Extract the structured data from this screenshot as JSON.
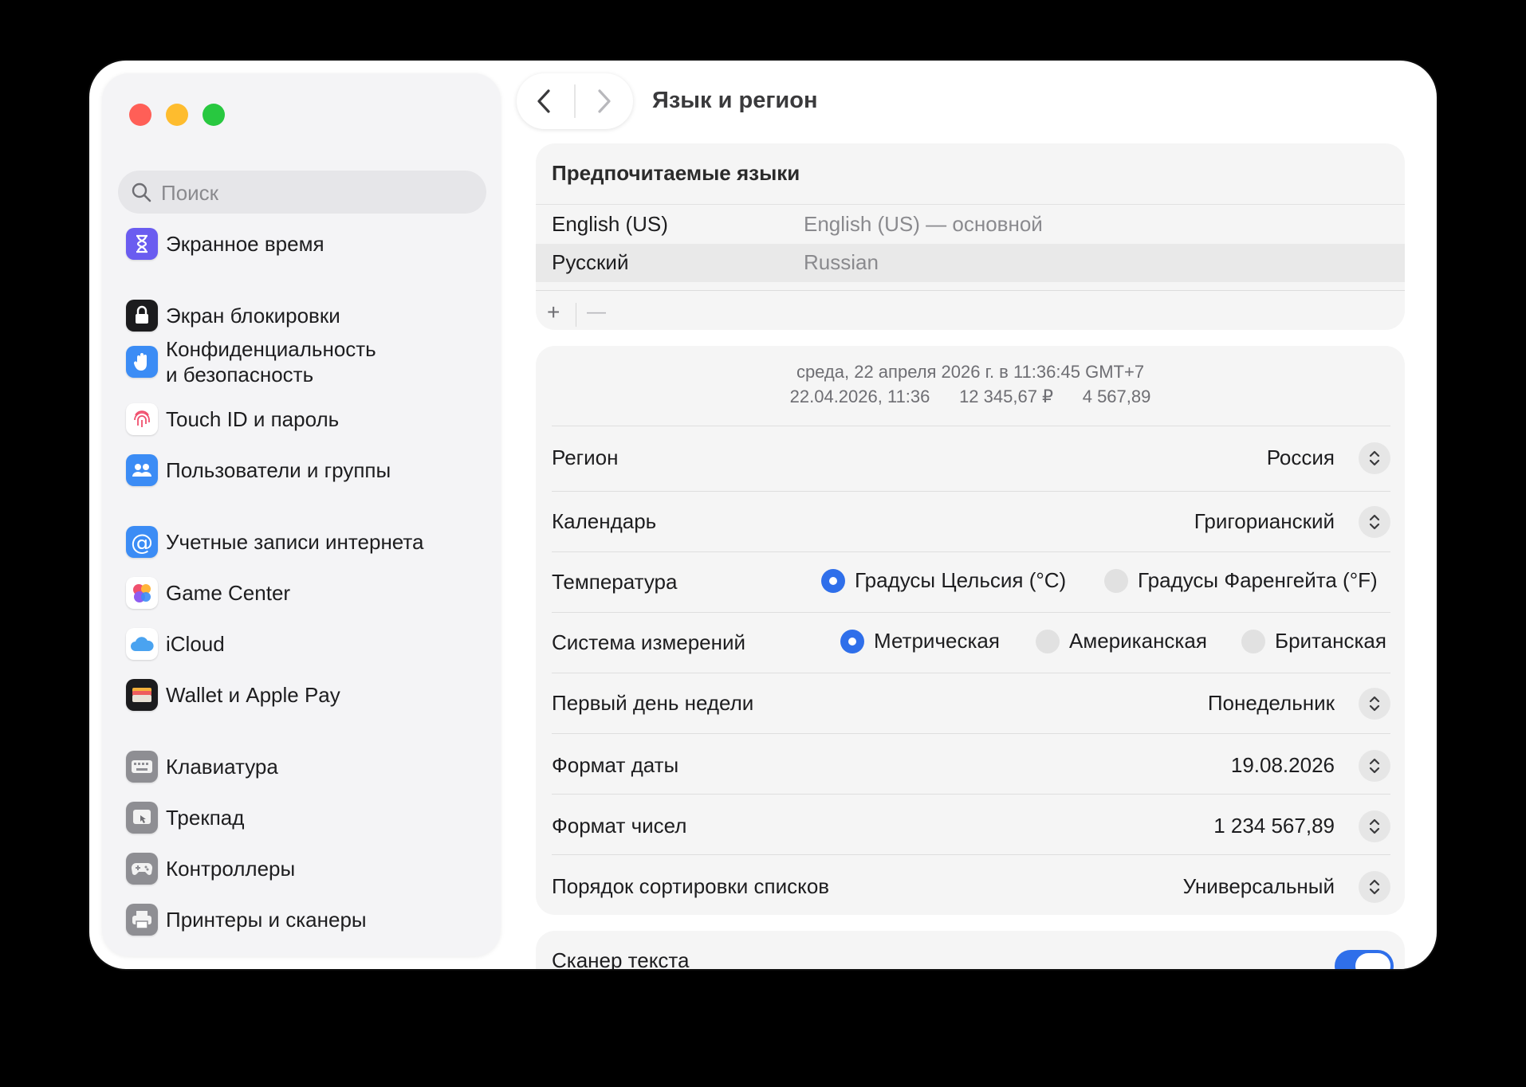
{
  "window": {
    "title": "Язык и регион"
  },
  "sidebar": {
    "search_placeholder": "Поиск",
    "items": [
      {
        "label": "Экранное время",
        "icon": "hourglass-icon"
      },
      {
        "label": "Экран блокировки",
        "icon": "lock-screen-icon"
      },
      {
        "label": "Конфиденциальность\nи безопасность",
        "icon": "hand-icon"
      },
      {
        "label": "Touch ID и пароль",
        "icon": "fingerprint-icon"
      },
      {
        "label": "Пользователи и группы",
        "icon": "users-icon"
      },
      {
        "label": "Учетные записи интернета",
        "icon": "at-icon"
      },
      {
        "label": "Game Center",
        "icon": "game-center-icon"
      },
      {
        "label": "iCloud",
        "icon": "cloud-icon"
      },
      {
        "label": "Wallet и Apple Pay",
        "icon": "wallet-icon"
      },
      {
        "label": "Клавиатура",
        "icon": "keyboard-icon"
      },
      {
        "label": "Трекпад",
        "icon": "trackpad-icon"
      },
      {
        "label": "Контроллеры",
        "icon": "gamepad-icon"
      },
      {
        "label": "Принтеры и сканеры",
        "icon": "printer-icon"
      }
    ]
  },
  "languages": {
    "heading": "Предпочитаемые языки",
    "rows": [
      {
        "name": "English (US)",
        "detail": "English (US) — основной"
      },
      {
        "name": "Русский",
        "detail": "Russian"
      }
    ],
    "add_label": "+",
    "remove_label": "—"
  },
  "region": {
    "preview_line1": "среда, 22 апреля 2026 г. в 11:36:45 GMT+7",
    "preview_line2": "22.04.2026, 11:36      12 345,67 ₽      4 567,89",
    "region_label": "Регион",
    "region_value": "Россия",
    "calendar_label": "Календарь",
    "calendar_value": "Григорианский",
    "temperature_label": "Температура",
    "temperature_options": [
      "Градусы Цельсия (°C)",
      "Градусы Фаренгейта (°F)"
    ],
    "temperature_selected": "Градусы Цельсия (°C)",
    "measurement_label": "Система измерений",
    "measurement_options": [
      "Метрическая",
      "Американская",
      "Британская"
    ],
    "measurement_selected": "Метрическая",
    "first_day_label": "Первый день недели",
    "first_day_value": "Понедельник",
    "date_format_label": "Формат даты",
    "date_format_value": "19.08.2026",
    "number_format_label": "Формат чисел",
    "number_format_value": "1 234 567,89",
    "sort_order_label": "Порядок сортировки списков",
    "sort_order_value": "Универсальный"
  },
  "text_scanner": {
    "label": "Сканер текста",
    "enabled": true
  },
  "colors": {
    "accent": "#2f6fea",
    "close": "#ff5f57",
    "minimize": "#febc2e",
    "zoom": "#28c840"
  }
}
